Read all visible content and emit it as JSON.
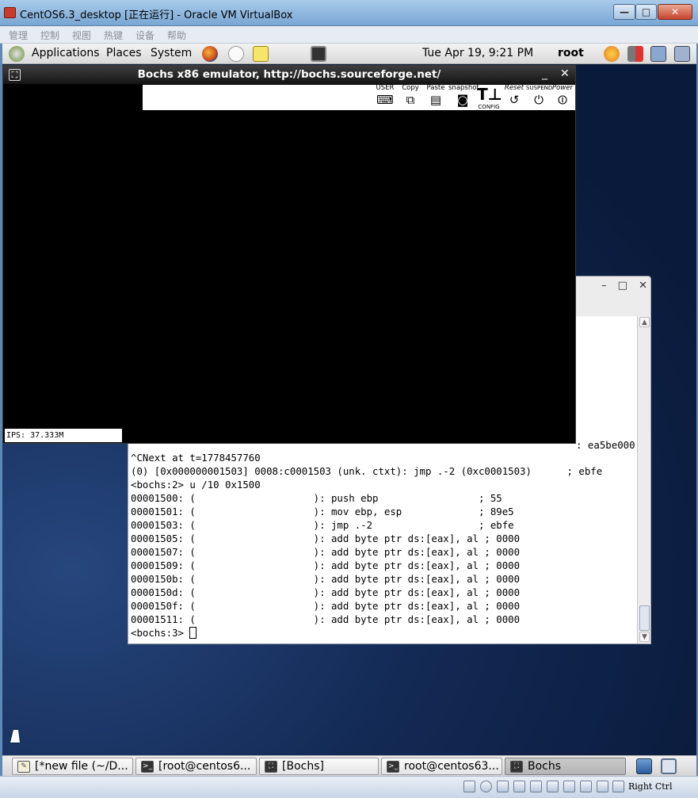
{
  "host_window": {
    "title": "CentOS6.3_desktop [正在运行] - Oracle VM VirtualBox",
    "controls": {
      "minimize": "—",
      "maximize": "□",
      "close": "✕"
    },
    "menu": [
      "管理",
      "控制",
      "视图",
      "热键",
      "设备",
      "帮助"
    ]
  },
  "gnome_top_panel": {
    "menus": [
      "Applications",
      "Places",
      "System"
    ],
    "launchers": [
      "firefox-icon",
      "mail-icon",
      "notes-icon",
      "terminal-icon"
    ],
    "clock": "Tue Apr 19,  9:21 PM",
    "user": "root",
    "tray": [
      "update-icon",
      "volume-muted-icon",
      "network-icon",
      "trash-icon"
    ]
  },
  "bochs": {
    "title": "Bochs x86 emulator, http://bochs.sourceforge.net/",
    "controls": {
      "minimize": "_",
      "close": "✕"
    },
    "toolbar": [
      {
        "name": "user-button",
        "label": "USER"
      },
      {
        "name": "copy-button",
        "label": "Copy"
      },
      {
        "name": "paste-button",
        "label": "Paste"
      },
      {
        "name": "snapshot-button",
        "label": "snapshot"
      },
      {
        "name": "config-button",
        "label": "CONFIG"
      },
      {
        "name": "reset-button",
        "label": "Reset"
      },
      {
        "name": "suspend-button",
        "label": "SUSPEND"
      },
      {
        "name": "power-button",
        "label": "Power"
      }
    ],
    "status": "IPS: 37.333M"
  },
  "terminal": {
    "partial_line": ": ea5be000",
    "lines": [
      "^CNext at t=1778457760",
      "(0) [0x000000001503] 0008:c0001503 (unk. ctxt): jmp .-2 (0xc0001503)      ; ebfe",
      "<bochs:2> u /10 0x1500",
      "00001500: (                    ): push ebp                 ; 55",
      "00001501: (                    ): mov ebp, esp             ; 89e5",
      "00001503: (                    ): jmp .-2                  ; ebfe",
      "00001505: (                    ): add byte ptr ds:[eax], al ; 0000",
      "00001507: (                    ): add byte ptr ds:[eax], al ; 0000",
      "00001509: (                    ): add byte ptr ds:[eax], al ; 0000",
      "0000150b: (                    ): add byte ptr ds:[eax], al ; 0000",
      "0000150d: (                    ): add byte ptr ds:[eax], al ; 0000",
      "0000150f: (                    ): add byte ptr ds:[eax], al ; 0000",
      "00001511: (                    ): add byte ptr ds:[eax], al ; 0000"
    ],
    "prompt": "<bochs:3> "
  },
  "taskbar": [
    {
      "label": "[*new file (~/D...",
      "icon": "text-editor-icon"
    },
    {
      "label": "[root@centos6...",
      "icon": "terminal-icon"
    },
    {
      "label": "[Bochs]",
      "icon": "bochs-icon"
    },
    {
      "label": "root@centos63...",
      "icon": "terminal-icon"
    },
    {
      "label": "Bochs",
      "icon": "bochs-icon",
      "active": true
    }
  ],
  "vbox_status": {
    "host_key": "Right Ctrl"
  },
  "colors": {
    "desktop": "#132a55",
    "panel": "#e4e4e4",
    "bochs_titlebar": "#151515",
    "terminal_bg": "#ffffff"
  }
}
